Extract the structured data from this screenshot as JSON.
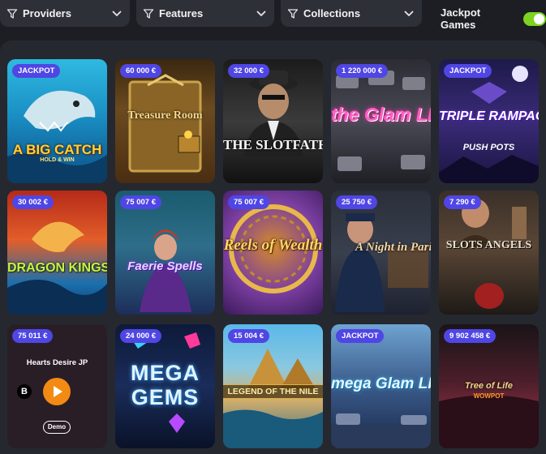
{
  "filters": {
    "providers": "Providers",
    "features": "Features",
    "collections": "Collections",
    "jackpot_label": "Jackpot Games",
    "jackpot_on": true
  },
  "games": [
    {
      "badge": "JACKPOT",
      "title": "A BIG CATCH",
      "sub": "HOLD & WIN"
    },
    {
      "badge": "60 000 €",
      "title": "Treasure Room",
      "sub": ""
    },
    {
      "badge": "32 000 €",
      "title": "THE SLOTFATHER",
      "sub": ""
    },
    {
      "badge": "1 220 000 €",
      "title": "the Glam LIFE",
      "sub": ""
    },
    {
      "badge": "JACKPOT",
      "title": "TRIPLE RAMPAGE",
      "sub": "PUSH POTS"
    },
    {
      "badge": "30 002 €",
      "title": "DRAGON KINGS",
      "sub": ""
    },
    {
      "badge": "75 007 €",
      "title": "Faerie Spells",
      "sub": ""
    },
    {
      "badge": "75 007 €",
      "title": "Reels of Wealth",
      "sub": ""
    },
    {
      "badge": "25 750 €",
      "title": "A Night in Paris",
      "sub": ""
    },
    {
      "badge": "7 290 €",
      "title": "SLOTS ANGELS",
      "sub": ""
    },
    {
      "badge": "75 011 €",
      "title": "Hearts Desire JP",
      "sub": "",
      "play": "Demo",
      "brand": "B"
    },
    {
      "badge": "24 000 €",
      "title": "MEGA GEMS",
      "sub": ""
    },
    {
      "badge": "15 004 €",
      "title": "LEGEND OF THE NILE",
      "sub": ""
    },
    {
      "badge": "JACKPOT",
      "title": "mega Glam LIFE",
      "sub": ""
    },
    {
      "badge": "9 902 458 €",
      "title": "Tree of Life",
      "sub": "WOWPOT"
    }
  ],
  "colors": {
    "badge": "#4f46e5",
    "toggle_on": "#7ed321",
    "play": "#f28a14",
    "panel": "#26282f"
  }
}
